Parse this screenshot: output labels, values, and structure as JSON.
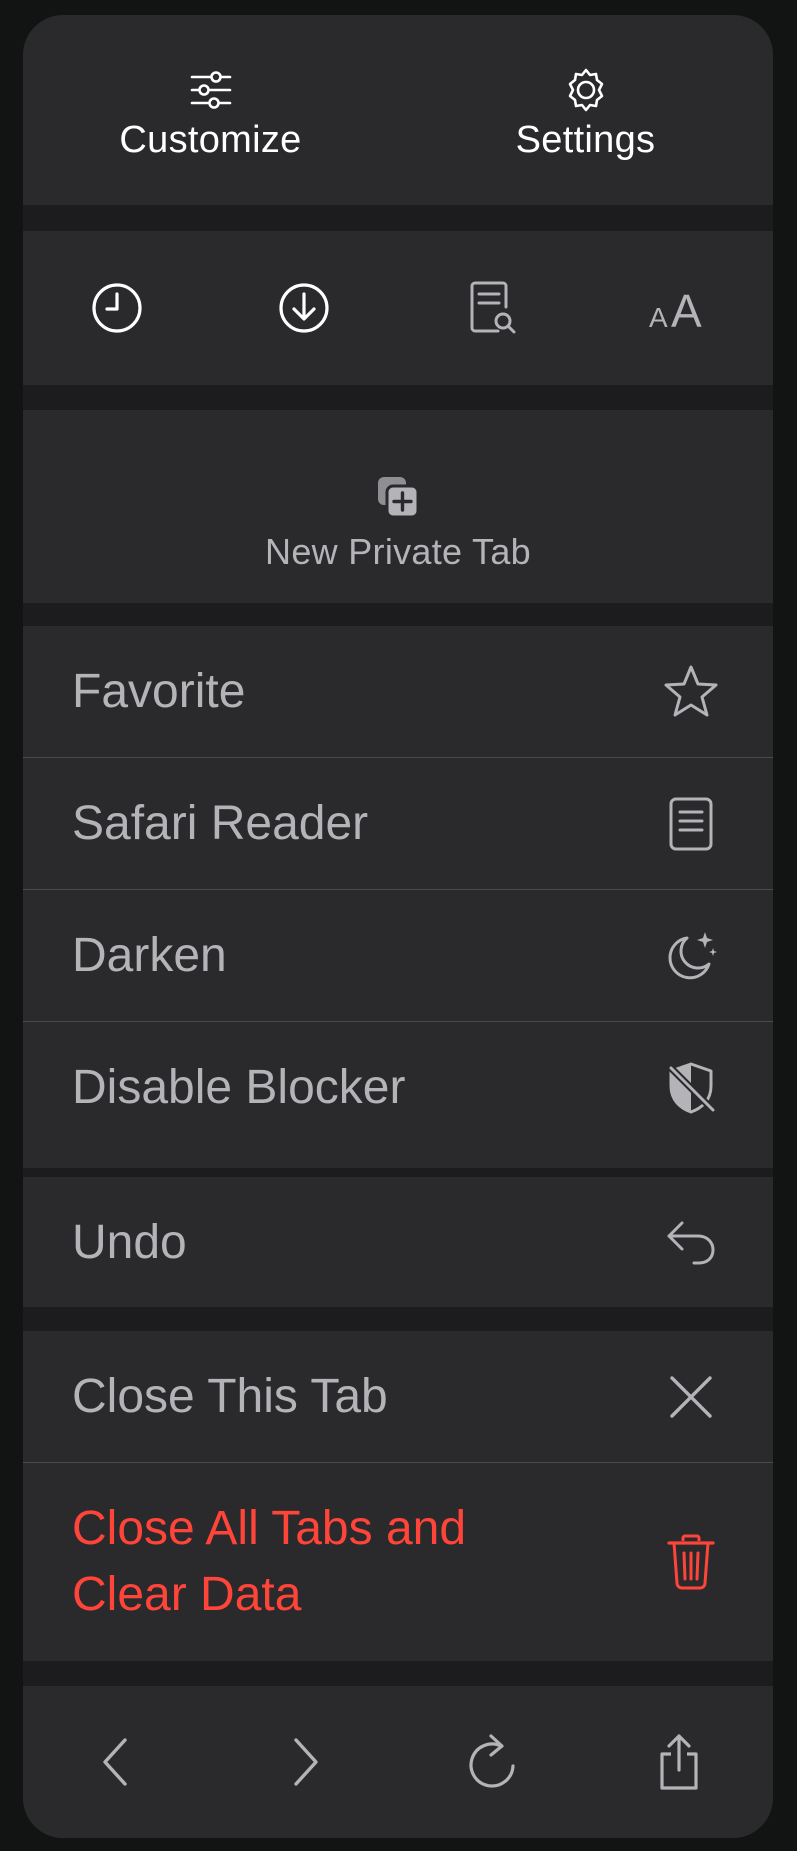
{
  "header": {
    "customize_label": "Customize",
    "settings_label": "Settings"
  },
  "quick_icons": [
    "history-icon",
    "downloads-icon",
    "find-in-page-icon",
    "text-size-icon"
  ],
  "private_tab": {
    "label": "New Private Tab"
  },
  "menu": {
    "favorite": "Favorite",
    "safari_reader": "Safari Reader",
    "darken": "Darken",
    "disable_blocker": "Disable Blocker",
    "undo": "Undo",
    "close_tab": "Close This Tab",
    "close_all_line1": "Close All Tabs and",
    "close_all_line2": "Clear Data"
  },
  "colors": {
    "panel_bg": "#2a2a2c",
    "text_primary": "#ffffff",
    "text_secondary": "#b3b3b8",
    "danger": "#ff453a"
  },
  "bottom_nav": [
    "back-icon",
    "forward-icon",
    "reload-icon",
    "share-icon"
  ]
}
